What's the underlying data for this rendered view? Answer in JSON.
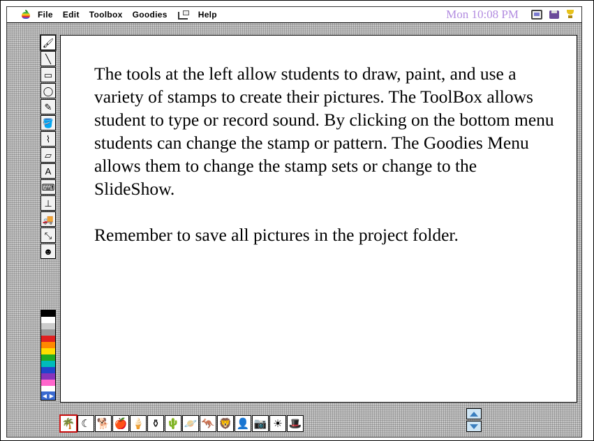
{
  "menubar": {
    "items": [
      "File",
      "Edit",
      "Toolbox",
      "Goodies",
      "Help"
    ],
    "clock": "Mon 10:08 PM"
  },
  "tools": [
    {
      "name": "wacky-brush-icon",
      "glyph": "🖌"
    },
    {
      "name": "line-tool-icon",
      "glyph": "╲"
    },
    {
      "name": "rectangle-tool-icon",
      "glyph": "▭"
    },
    {
      "name": "oval-tool-icon",
      "glyph": "◯"
    },
    {
      "name": "pencil-tool-icon",
      "glyph": "✎"
    },
    {
      "name": "paint-bucket-icon",
      "glyph": "🪣"
    },
    {
      "name": "wacky-brush-2-icon",
      "glyph": "⌇"
    },
    {
      "name": "eraser-tool-icon",
      "glyph": "▱"
    },
    {
      "name": "text-tool-icon",
      "glyph": "A"
    },
    {
      "name": "typewriter-icon",
      "glyph": "⌨"
    },
    {
      "name": "stamp-tool-icon",
      "glyph": "⊥"
    },
    {
      "name": "truck-tool-icon",
      "glyph": "🚚"
    },
    {
      "name": "eyedropper-tool-icon",
      "glyph": "⤡"
    },
    {
      "name": "undo-tool-icon",
      "glyph": "☻"
    }
  ],
  "colors": [
    "#000000",
    "#ffffff",
    "#cccccc",
    "#999999",
    "#e02020",
    "#ff8800",
    "#ffdd00",
    "#22aa22",
    "#00bbbb",
    "#2244cc",
    "#8833bb",
    "#ff66cc"
  ],
  "canvas": {
    "paragraph1": "The tools at the left allow students to draw, paint, and use a variety of stamps to create their pictures.  The ToolBox allows student to type or record sound.  By clicking on the bottom menu students can change the stamp or pattern.  The Goodies Menu allows them to change the stamp sets or change to the SlideShow.",
    "paragraph2": "Remember to save all pictures in the project folder."
  },
  "stamps": [
    {
      "name": "palm-tree-stamp-icon",
      "glyph": "🌴"
    },
    {
      "name": "moon-stamp-icon",
      "glyph": "☾"
    },
    {
      "name": "dog-stamp-icon",
      "glyph": "🐕"
    },
    {
      "name": "apple-stamp-icon",
      "glyph": "🍎"
    },
    {
      "name": "ice-cream-stamp-icon",
      "glyph": "🍦"
    },
    {
      "name": "bottle-stamp-icon",
      "glyph": "⚱"
    },
    {
      "name": "cactus-stamp-icon",
      "glyph": "🌵"
    },
    {
      "name": "planet-stamp-icon",
      "glyph": "🪐"
    },
    {
      "name": "kangaroo-stamp-icon",
      "glyph": "🦘"
    },
    {
      "name": "lion-stamp-icon",
      "glyph": "🦁"
    },
    {
      "name": "face-stamp-icon",
      "glyph": "👤"
    },
    {
      "name": "camera-stamp-icon",
      "glyph": "📷"
    },
    {
      "name": "sun-stamp-icon",
      "glyph": "☀"
    },
    {
      "name": "hat-stamp-icon",
      "glyph": "🎩"
    }
  ]
}
